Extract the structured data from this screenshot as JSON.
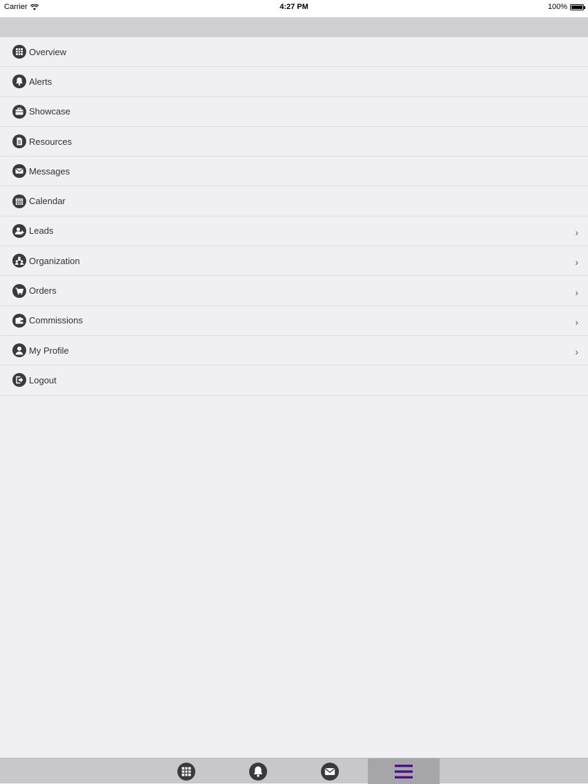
{
  "status_bar": {
    "carrier": "Carrier",
    "time": "4:27 PM",
    "battery": "100%"
  },
  "menu": {
    "items": [
      {
        "label": "Overview",
        "icon": "grid-icon",
        "has_chevron": false
      },
      {
        "label": "Alerts",
        "icon": "bell-icon",
        "has_chevron": false
      },
      {
        "label": "Showcase",
        "icon": "briefcase-icon",
        "has_chevron": false
      },
      {
        "label": "Resources",
        "icon": "document-icon",
        "has_chevron": false
      },
      {
        "label": "Messages",
        "icon": "envelope-icon",
        "has_chevron": false
      },
      {
        "label": "Calendar",
        "icon": "calendar-icon",
        "has_chevron": false
      },
      {
        "label": "Leads",
        "icon": "add-user-icon",
        "has_chevron": true
      },
      {
        "label": "Organization",
        "icon": "organization-icon",
        "has_chevron": true
      },
      {
        "label": "Orders",
        "icon": "cart-icon",
        "has_chevron": true
      },
      {
        "label": "Commissions",
        "icon": "wallet-icon",
        "has_chevron": true
      },
      {
        "label": "My Profile",
        "icon": "user-icon",
        "has_chevron": true
      },
      {
        "label": "Logout",
        "icon": "logout-icon",
        "has_chevron": false
      }
    ],
    "chevron": "›"
  },
  "tab_bar": {
    "tabs": [
      {
        "name": "overview",
        "icon": "grid-icon",
        "active": false
      },
      {
        "name": "alerts",
        "icon": "bell-icon",
        "active": false
      },
      {
        "name": "messages",
        "icon": "envelope-icon",
        "active": false
      },
      {
        "name": "menu",
        "icon": "hamburger-icon",
        "active": true
      }
    ]
  },
  "colors": {
    "icon": "#3a3a3c",
    "active_tab_icon": "#4b0f86",
    "background": "#efeff4",
    "nav_bar": "#d0d0d4",
    "tab_bar": "#c8c8cc"
  }
}
